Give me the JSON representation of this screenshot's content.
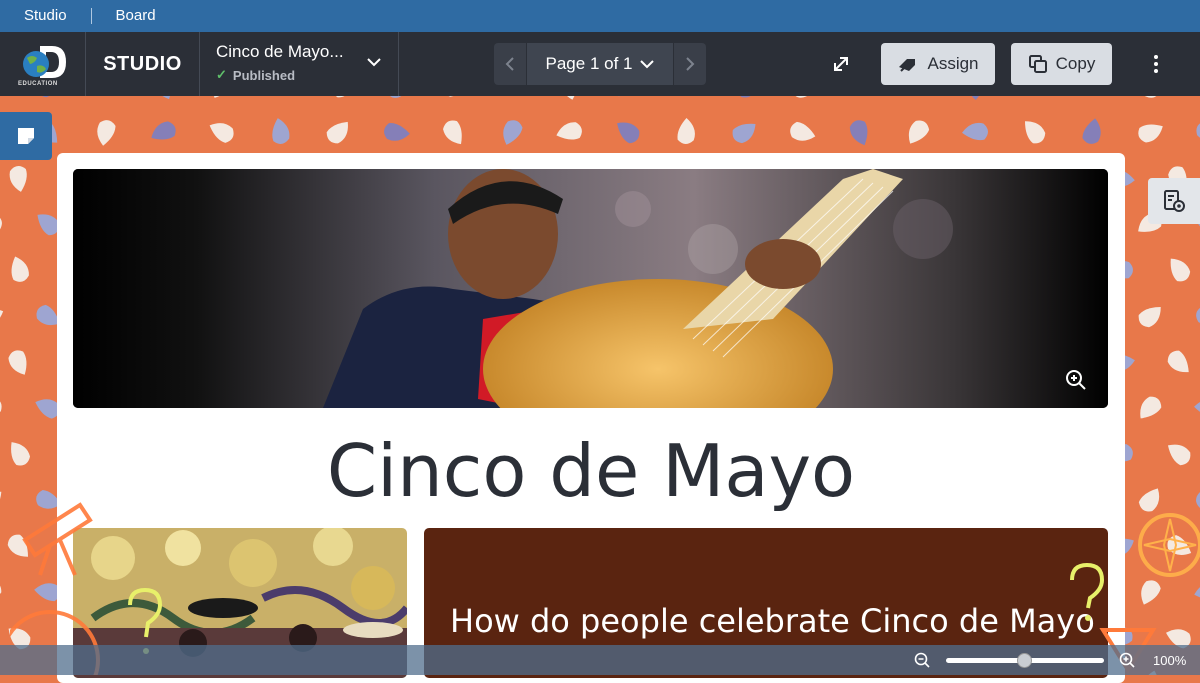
{
  "breadcrumbs": [
    "Studio",
    "Board"
  ],
  "toolbar": {
    "logo_text": "EDUCATION",
    "app_name": "STUDIO",
    "doc_title": "Cinco de Mayo...",
    "doc_status": "Published",
    "pager_label": "Page 1 of 1",
    "assign_label": "Assign",
    "copy_label": "Copy"
  },
  "board": {
    "heading": "Cinco de Mayo",
    "question": "How do people celebrate Cinco de Mayo"
  },
  "zoom": {
    "level_text": "100%",
    "slider_fraction": 0.5
  },
  "colors": {
    "crumb_bar": "#2f6ba3",
    "toolbar": "#2b2f37",
    "background_pattern": "#e8784a",
    "question_card": "#5a2410",
    "published_check": "#5fbf6a"
  },
  "icons": {
    "note": "sticky-note-icon",
    "side_panel": "document-settings-icon",
    "expand": "expand-icon",
    "assign": "assign-icon",
    "copy": "copy-icon",
    "more": "kebab-menu-icon",
    "image_zoom": "zoom-in-icon",
    "zoom_out": "zoom-out-icon",
    "zoom_in": "zoom-in-icon"
  }
}
